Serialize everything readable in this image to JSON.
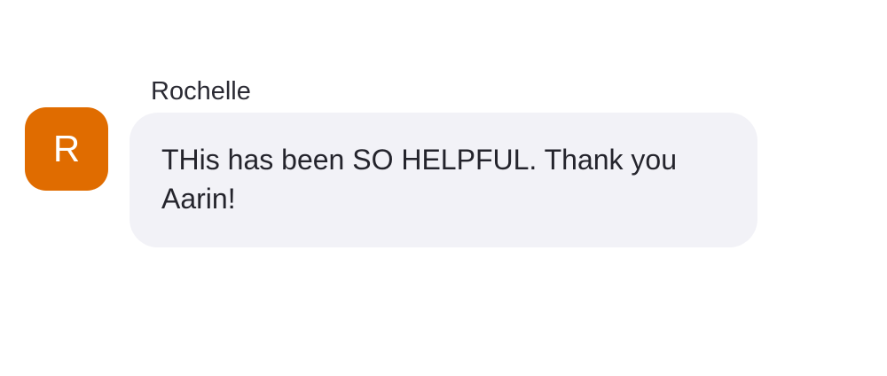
{
  "message": {
    "sender_name": "Rochelle",
    "avatar_initial": "R",
    "text": "THis has been SO HELPFUL. Thank you Aarin!"
  },
  "colors": {
    "avatar_background": "#e06c00",
    "bubble_background": "#f2f2f7",
    "text": "#24242c"
  }
}
